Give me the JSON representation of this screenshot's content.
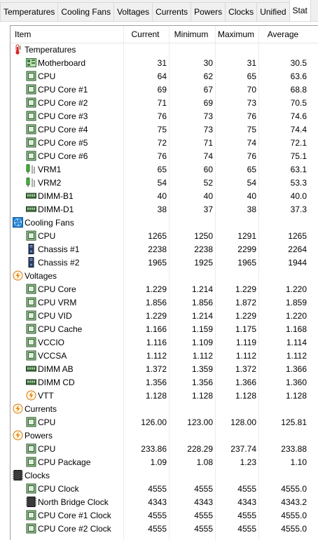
{
  "tabs": [
    "Temperatures",
    "Cooling Fans",
    "Voltages",
    "Currents",
    "Powers",
    "Clocks",
    "Unified",
    "Stat"
  ],
  "selected_tab": 7,
  "columns": {
    "item": "Item",
    "current": "Current",
    "minimum": "Minimum",
    "maximum": "Maximum",
    "average": "Average"
  },
  "groups": [
    {
      "label": "Temperatures",
      "icon": "thermometer-icon",
      "rows": [
        {
          "name": "Motherboard",
          "icon": "motherboard-icon",
          "cur": "31",
          "min": "30",
          "max": "31",
          "avg": "30.5"
        },
        {
          "name": "CPU",
          "icon": "chip-icon",
          "cur": "64",
          "min": "62",
          "max": "65",
          "avg": "63.6"
        },
        {
          "name": "CPU Core #1",
          "icon": "chip-icon",
          "cur": "69",
          "min": "67",
          "max": "70",
          "avg": "68.8"
        },
        {
          "name": "CPU Core #2",
          "icon": "chip-icon",
          "cur": "71",
          "min": "69",
          "max": "73",
          "avg": "70.5"
        },
        {
          "name": "CPU Core #3",
          "icon": "chip-icon",
          "cur": "76",
          "min": "73",
          "max": "76",
          "avg": "74.6"
        },
        {
          "name": "CPU Core #4",
          "icon": "chip-icon",
          "cur": "75",
          "min": "73",
          "max": "75",
          "avg": "74.4"
        },
        {
          "name": "CPU Core #5",
          "icon": "chip-icon",
          "cur": "72",
          "min": "71",
          "max": "74",
          "avg": "72.1"
        },
        {
          "name": "CPU Core #6",
          "icon": "chip-icon",
          "cur": "76",
          "min": "74",
          "max": "76",
          "avg": "75.1"
        },
        {
          "name": "VRM1",
          "icon": "vrm-icon",
          "cur": "65",
          "min": "60",
          "max": "65",
          "avg": "63.1"
        },
        {
          "name": "VRM2",
          "icon": "vrm-icon",
          "cur": "54",
          "min": "52",
          "max": "54",
          "avg": "53.3"
        },
        {
          "name": "DIMM-B1",
          "icon": "ram-icon",
          "cur": "40",
          "min": "40",
          "max": "40",
          "avg": "40.0"
        },
        {
          "name": "DIMM-D1",
          "icon": "ram-icon",
          "cur": "38",
          "min": "37",
          "max": "38",
          "avg": "37.3"
        }
      ]
    },
    {
      "label": "Cooling Fans",
      "icon": "fan-icon",
      "rows": [
        {
          "name": "CPU",
          "icon": "chip-icon",
          "cur": "1265",
          "min": "1250",
          "max": "1291",
          "avg": "1265"
        },
        {
          "name": "Chassis #1",
          "icon": "chassis-icon",
          "cur": "2238",
          "min": "2238",
          "max": "2299",
          "avg": "2264"
        },
        {
          "name": "Chassis #2",
          "icon": "chassis-icon",
          "cur": "1965",
          "min": "1925",
          "max": "1965",
          "avg": "1944"
        }
      ]
    },
    {
      "label": "Voltages",
      "icon": "lightning-icon",
      "rows": [
        {
          "name": "CPU Core",
          "icon": "chip-icon",
          "cur": "1.229",
          "min": "1.214",
          "max": "1.229",
          "avg": "1.220"
        },
        {
          "name": "CPU VRM",
          "icon": "chip-icon",
          "cur": "1.856",
          "min": "1.856",
          "max": "1.872",
          "avg": "1.859"
        },
        {
          "name": "CPU VID",
          "icon": "chip-icon",
          "cur": "1.229",
          "min": "1.214",
          "max": "1.229",
          "avg": "1.220"
        },
        {
          "name": "CPU Cache",
          "icon": "chip-icon",
          "cur": "1.166",
          "min": "1.159",
          "max": "1.175",
          "avg": "1.168"
        },
        {
          "name": "VCCIO",
          "icon": "chip-icon",
          "cur": "1.116",
          "min": "1.109",
          "max": "1.119",
          "avg": "1.114"
        },
        {
          "name": "VCCSA",
          "icon": "chip-icon",
          "cur": "1.112",
          "min": "1.112",
          "max": "1.112",
          "avg": "1.112"
        },
        {
          "name": "DIMM AB",
          "icon": "ram-icon",
          "cur": "1.372",
          "min": "1.359",
          "max": "1.372",
          "avg": "1.366"
        },
        {
          "name": "DIMM CD",
          "icon": "ram-icon",
          "cur": "1.356",
          "min": "1.356",
          "max": "1.366",
          "avg": "1.360"
        },
        {
          "name": "VTT",
          "icon": "lightning-icon",
          "cur": "1.128",
          "min": "1.128",
          "max": "1.128",
          "avg": "1.128"
        }
      ]
    },
    {
      "label": "Currents",
      "icon": "lightning-icon",
      "rows": [
        {
          "name": "CPU",
          "icon": "chip-icon",
          "cur": "126.00",
          "min": "123.00",
          "max": "128.00",
          "avg": "125.81"
        }
      ]
    },
    {
      "label": "Powers",
      "icon": "lightning-icon",
      "rows": [
        {
          "name": "CPU",
          "icon": "chip-icon",
          "cur": "233.86",
          "min": "228.29",
          "max": "237.74",
          "avg": "233.88"
        },
        {
          "name": "CPU Package",
          "icon": "chip-icon",
          "cur": "1.09",
          "min": "1.08",
          "max": "1.23",
          "avg": "1.10"
        }
      ]
    },
    {
      "label": "Clocks",
      "icon": "clock-chip-icon",
      "rows": [
        {
          "name": "CPU Clock",
          "icon": "chip-icon",
          "cur": "4555",
          "min": "4555",
          "max": "4555",
          "avg": "4555.0"
        },
        {
          "name": "North Bridge Clock",
          "icon": "clock-chip-icon",
          "cur": "4343",
          "min": "4343",
          "max": "4343",
          "avg": "4343.2"
        },
        {
          "name": "CPU Core #1 Clock",
          "icon": "chip-icon",
          "cur": "4555",
          "min": "4555",
          "max": "4555",
          "avg": "4555.0"
        },
        {
          "name": "CPU Core #2 Clock",
          "icon": "chip-icon",
          "cur": "4555",
          "min": "4555",
          "max": "4555",
          "avg": "4555.0"
        }
      ]
    }
  ]
}
